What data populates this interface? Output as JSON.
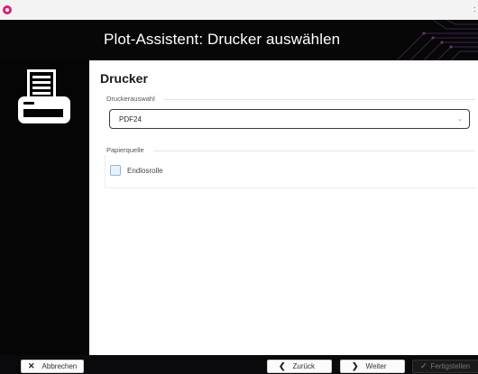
{
  "window": {
    "title": "Plot-Assistent: Drucker auswählen"
  },
  "icons": {
    "app": "app-logo-icon",
    "printer": "printer-icon",
    "chevron": "chevron-down-icon"
  },
  "panel": {
    "title": "Drucker",
    "printer_group_label": "Druckerauswahl",
    "printer_selected": "PDF24",
    "paper_group_label": "Papierquelle",
    "continuous_roll_label": "Endlosrolle",
    "continuous_roll_checked": false
  },
  "footer": {
    "cancel_label": "Abbrechen",
    "back_label": "Zurück",
    "next_label": "Weiter",
    "finish_label": "Fertigstellen"
  },
  "colors": {
    "accent": "#d9216f",
    "checkbox_fill": "#e9f2fc",
    "checkbox_border": "#8fb6e0"
  }
}
